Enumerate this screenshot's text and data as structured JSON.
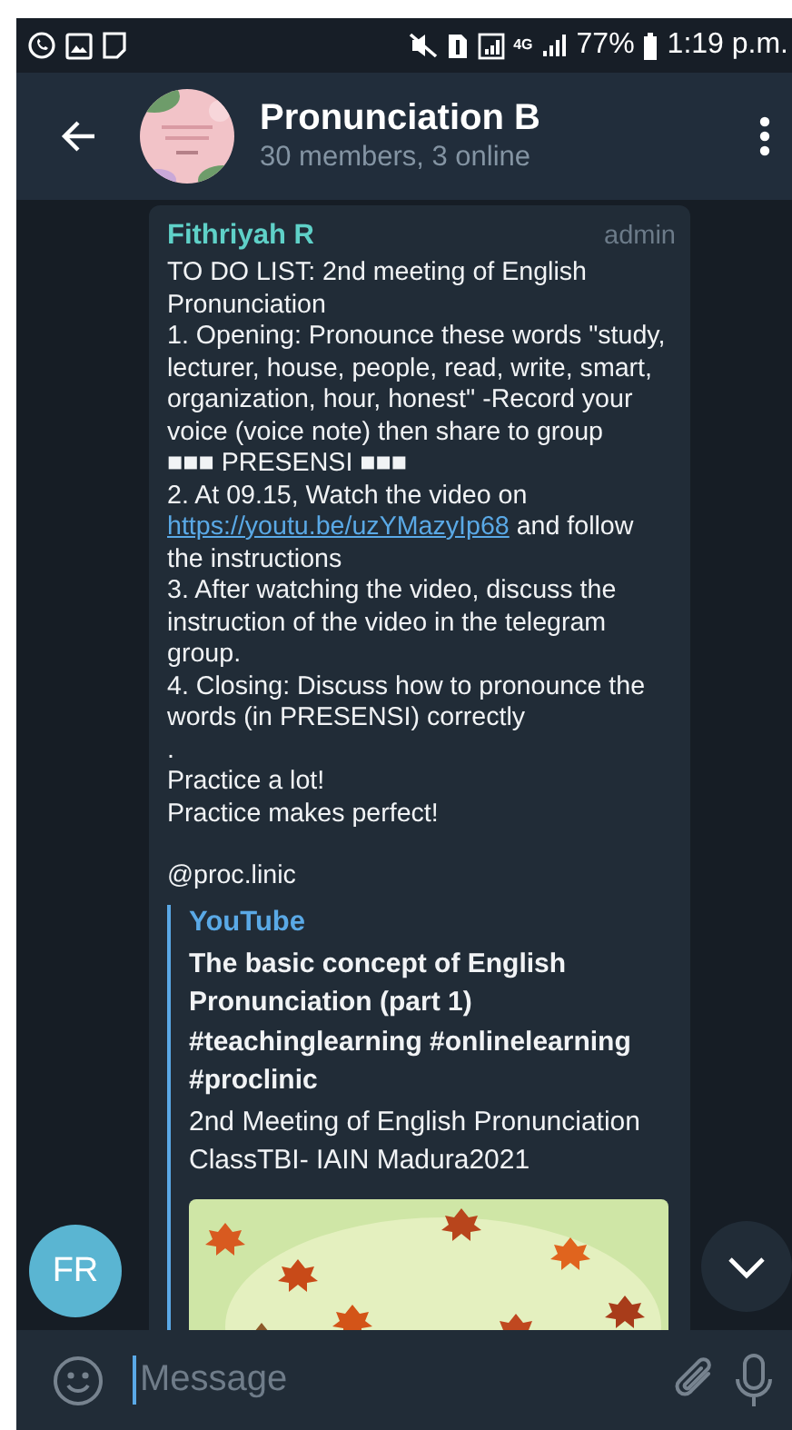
{
  "status_bar": {
    "network": "4G",
    "battery": "77%",
    "time": "1:19 p.m."
  },
  "header": {
    "title": "Pronunciation B",
    "subtitle": "30 members, 3 online"
  },
  "message": {
    "sender": "Fithriyah R",
    "role": "admin",
    "paragraphs": [
      [
        {
          "text": "TO DO LIST: 2nd meeting of English Pronunciation"
        }
      ],
      [
        {
          "text": "1. Opening: Pronounce these words \"study, lecturer, house, people, read, write, smart, organization, hour, honest\" -Record your voice (voice note) then share to group"
        }
      ],
      [
        {
          "text": "■■■ PRESENSI ■■■"
        }
      ],
      [
        {
          "text": "2. At 09.15, Watch the video on "
        },
        {
          "link": "https://youtu.be/uzYMazyIp68"
        },
        {
          "text": " and follow the instructions"
        }
      ],
      [
        {
          "text": "3. After watching the video, discuss the instruction of the video in the telegram group."
        }
      ],
      [
        {
          "text": "4. Closing: Discuss how to pronounce the words (in PRESENSI) correctly"
        }
      ],
      [
        {
          "text": "."
        }
      ],
      [
        {
          "text": "Practice a lot!"
        }
      ],
      [
        {
          "text": "Practice makes perfect!"
        }
      ]
    ],
    "signature": "@proc.linic",
    "preview": {
      "site": "YouTube",
      "title": "The basic concept of English Pronunciation (part 1) #teachinglearning #onlinelearning #proclinic",
      "description": "2nd Meeting of English Pronunciation ClassTBI- IAIN Madura2021"
    }
  },
  "sender_avatar": {
    "initials": "FR"
  },
  "composer": {
    "placeholder": "Message"
  }
}
